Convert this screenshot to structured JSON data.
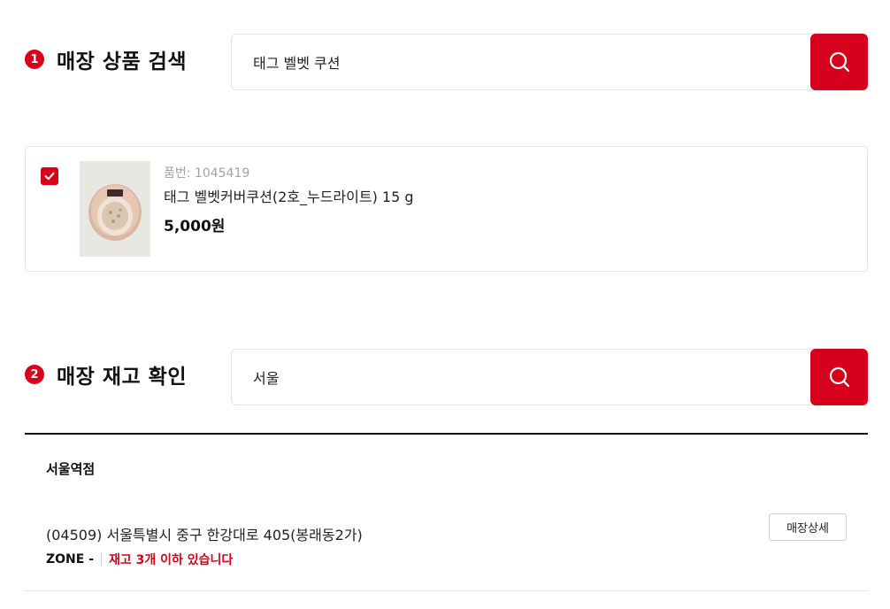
{
  "product_search": {
    "step": "1",
    "title": "매장 상품 검색",
    "query": "태그 벨벳 쿠션",
    "search_icon": "search-icon"
  },
  "product": {
    "checked": true,
    "code": "품번: 1045419",
    "name": "태그 벨벳커버쿠션(2호_누드라이트) 15 g",
    "price": "5,000원",
    "image_icon": "cushion-compact-image"
  },
  "stock_search": {
    "step": "2",
    "title": "매장 재고 확인",
    "query": "서울",
    "search_icon": "search-icon"
  },
  "store": {
    "name": "서울역점",
    "address": "(04509) 서울특별시 중구 한강대로 405(봉래동2가)",
    "zone": "ZONE -",
    "stock_status": "재고 3개 이하 있습니다",
    "detail_button": "매장상세"
  },
  "colors": {
    "accent": "#d6001c",
    "border": "#e3e3e3"
  }
}
